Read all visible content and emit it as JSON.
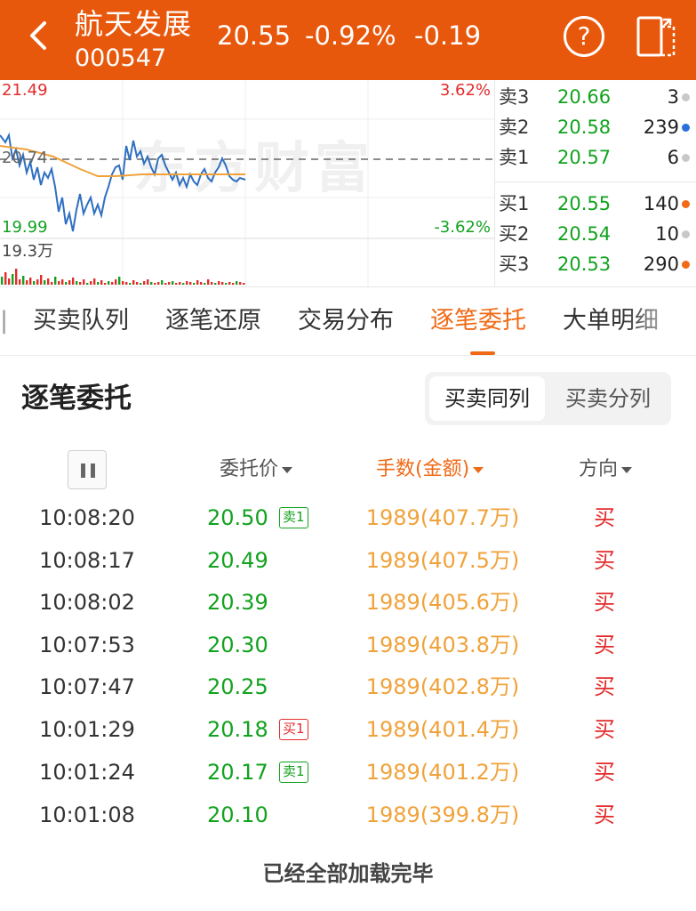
{
  "header": {
    "stock_name": "航天发展",
    "stock_code": "000547",
    "price": "20.55",
    "change_pct": "-0.92%",
    "change_amt": "-0.19",
    "help_glyph": "?"
  },
  "chart": {
    "high_price": "21.49",
    "high_pct": "3.62%",
    "prev_close": "20.74",
    "low_price": "19.99",
    "low_pct": "-3.62%",
    "volume_label": "19.3万",
    "watermark": "东方财富"
  },
  "order_book": {
    "asks": [
      {
        "side": "卖3",
        "price": "20.66",
        "volume": "3",
        "dot": "#c8c8c8"
      },
      {
        "side": "卖2",
        "price": "20.58",
        "volume": "239",
        "dot": "#2a6fdb"
      },
      {
        "side": "卖1",
        "price": "20.57",
        "volume": "6",
        "dot": "#c8c8c8"
      }
    ],
    "bids": [
      {
        "side": "买1",
        "price": "20.55",
        "volume": "140",
        "dot": "#f06a16"
      },
      {
        "side": "买2",
        "price": "20.54",
        "volume": "10",
        "dot": "#c8c8c8"
      },
      {
        "side": "买3",
        "price": "20.53",
        "volume": "290",
        "dot": "#f06a16"
      }
    ]
  },
  "tabs": {
    "items": [
      "买卖队列",
      "逐笔还原",
      "交易分布",
      "逐笔委托",
      "大单明细"
    ],
    "active": "逐笔委托",
    "partial_left": "|"
  },
  "section": {
    "title": "逐笔委托",
    "toggle_on": "买卖同列",
    "toggle_off": "买卖分列"
  },
  "table": {
    "headers": {
      "price": "委托价",
      "volume": "手数(金额)",
      "direction": "方向"
    },
    "rows": [
      {
        "time": "10:08:20",
        "price": "20.50",
        "tag": "卖1",
        "tag_type": "sell",
        "volume": "1989(407.7万)",
        "direction": "买"
      },
      {
        "time": "10:08:17",
        "price": "20.49",
        "tag": "",
        "tag_type": "",
        "volume": "1989(407.5万)",
        "direction": "买"
      },
      {
        "time": "10:08:02",
        "price": "20.39",
        "tag": "",
        "tag_type": "",
        "volume": "1989(405.6万)",
        "direction": "买"
      },
      {
        "time": "10:07:53",
        "price": "20.30",
        "tag": "",
        "tag_type": "",
        "volume": "1989(403.8万)",
        "direction": "买"
      },
      {
        "time": "10:07:47",
        "price": "20.25",
        "tag": "",
        "tag_type": "",
        "volume": "1989(402.8万)",
        "direction": "买"
      },
      {
        "time": "10:01:29",
        "price": "20.18",
        "tag": "买1",
        "tag_type": "buy",
        "volume": "1989(401.4万)",
        "direction": "买"
      },
      {
        "time": "10:01:24",
        "price": "20.17",
        "tag": "卖1",
        "tag_type": "sell",
        "volume": "1989(401.2万)",
        "direction": "买"
      },
      {
        "time": "10:01:08",
        "price": "20.10",
        "tag": "",
        "tag_type": "",
        "volume": "1989(399.8万)",
        "direction": "买"
      }
    ]
  },
  "footer": {
    "text": "已经全部加载完毕"
  },
  "colors": {
    "brand": "#e8580c",
    "accent": "#f06a16",
    "up": "#e32b2b",
    "down": "#12a21f",
    "volume_text": "#f0a23a",
    "price_line": "#2f6fc0",
    "avg_line": "#f0a23a"
  },
  "icons": {
    "back": "chevron-left-icon",
    "help": "question-circle-icon",
    "switch": "landscape-switch-icon",
    "pause": "pause-icon",
    "dropdown": "caret-down-icon"
  }
}
